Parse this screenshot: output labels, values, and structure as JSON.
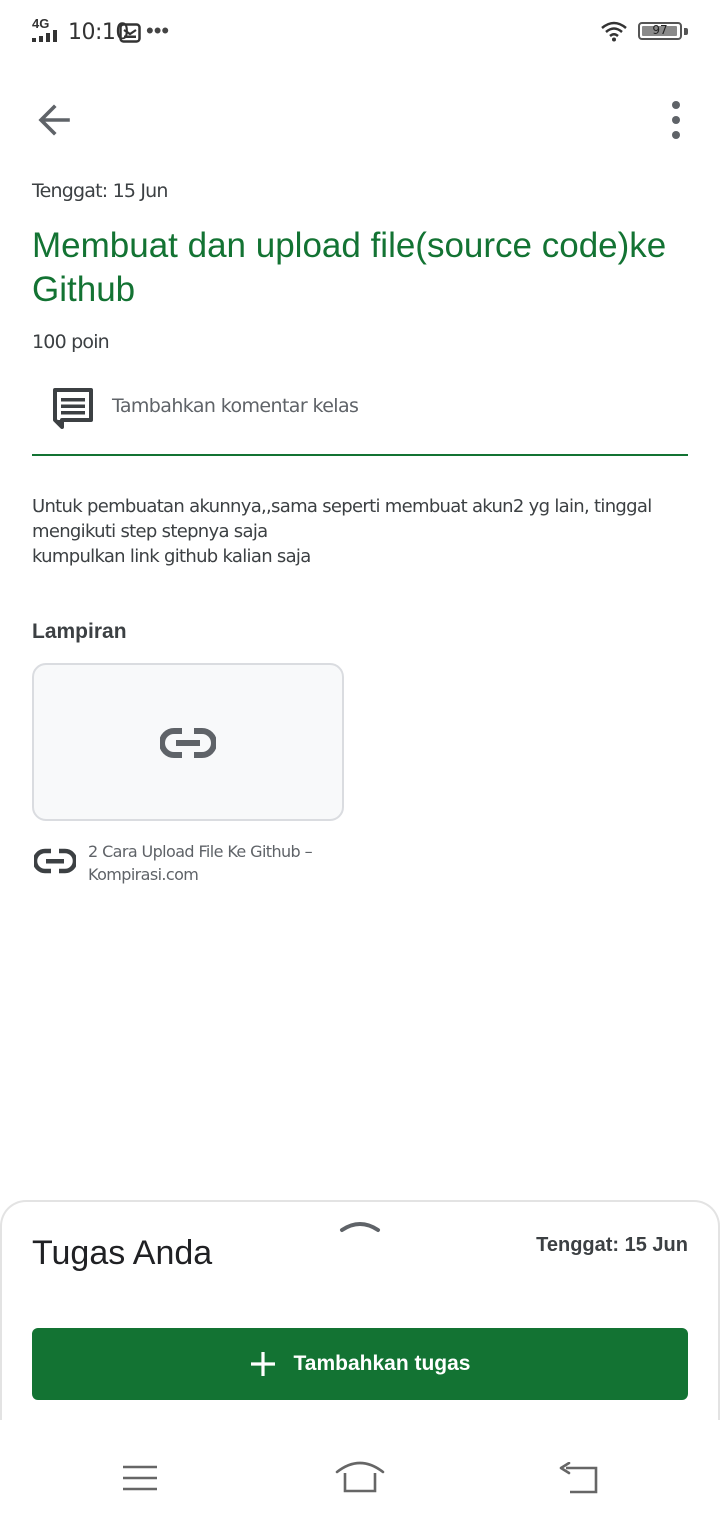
{
  "status_bar": {
    "network": "4G",
    "time": "10:10",
    "battery": "97",
    "battery_level": 0.97,
    "icons": [
      "signal-icon",
      "message-icon",
      "more-dots-icon",
      "wifi-icon",
      "battery-icon"
    ]
  },
  "toolbar": {
    "back_icon": "arrow-back-icon",
    "more_icon": "more-vert-icon"
  },
  "assignment": {
    "due": "Tenggat: 15 Jun",
    "title": "Membuat dan upload file(source code)ke Github",
    "points": "100 poin",
    "comment_label": "Tambahkan komentar kelas",
    "description_lines": [
      "Untuk pembuatan akunnya,,sama seperti membuat akun2 yg lain, tinggal mengikuti step stepnya saja",
      "kumpulkan link github kalian saja"
    ]
  },
  "attachments": {
    "heading": "Lampiran",
    "items": [
      {
        "icon": "link-icon",
        "title": "2 Cara Upload File Ke Github – Kompirasi.com"
      }
    ]
  },
  "bottom_sheet": {
    "title": "Tugas Anda",
    "due": "Tenggat: 15 Jun",
    "add_button_label": "Tambahkan tugas"
  },
  "colors": {
    "accent": "#137333",
    "text": "#202124",
    "secondary_text": "#5f6368"
  }
}
